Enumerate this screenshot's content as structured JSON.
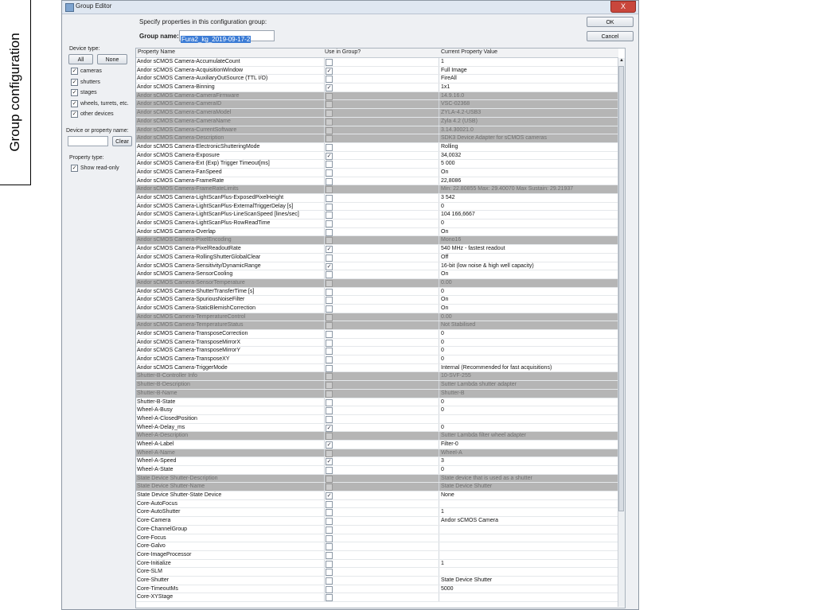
{
  "slide_label": "Group configuration",
  "window": {
    "title": "Group Editor",
    "close_label": "X"
  },
  "header": {
    "specify_text": "Specify properties in this configuration group:",
    "group_name_label": "Group name:",
    "group_name_value": "Fura2_kg_2019-09-17-2"
  },
  "buttons": {
    "ok": "OK",
    "cancel": "Cancel",
    "all": "All",
    "none": "None",
    "clear": "Clear"
  },
  "sidebar": {
    "device_type_label": "Device type:",
    "device_types": [
      {
        "label": "cameras",
        "checked": true
      },
      {
        "label": "shutters",
        "checked": true
      },
      {
        "label": "stages",
        "checked": true
      },
      {
        "label": "wheels, turrets, etc.",
        "checked": true
      },
      {
        "label": "other devices",
        "checked": true
      }
    ],
    "filter_label": "Device or property name:",
    "property_type_label": "Property type:",
    "show_readonly_label": "Show read-only"
  },
  "table": {
    "headers": [
      "Property Name",
      "Use in Group?",
      "Current Property Value"
    ],
    "rows": [
      {
        "name": "Andor sCMOS Camera-AccumulateCount",
        "use": false,
        "value": "1",
        "ro": false
      },
      {
        "name": "Andor sCMOS Camera-AcquisitionWindow",
        "use": true,
        "value": "Full Image",
        "ro": false
      },
      {
        "name": "Andor sCMOS Camera-AuxiliaryOutSource (TTL I/O)",
        "use": false,
        "value": "FireAll",
        "ro": false
      },
      {
        "name": "Andor sCMOS Camera-Binning",
        "use": true,
        "value": "1x1",
        "ro": false
      },
      {
        "name": "Andor sCMOS Camera-CameraFirmware",
        "use": false,
        "value": "14.9.16.0",
        "ro": true
      },
      {
        "name": "Andor sCMOS Camera-CameraID",
        "use": false,
        "value": "VSC-02368",
        "ro": true
      },
      {
        "name": "Andor sCMOS Camera-CameraModel",
        "use": false,
        "value": "ZYLA-4.2-USB3",
        "ro": true
      },
      {
        "name": "Andor sCMOS Camera-CameraName",
        "use": false,
        "value": "Zyla 4.2 (USB)",
        "ro": true
      },
      {
        "name": "Andor sCMOS Camera-CurrentSoftware",
        "use": false,
        "value": "3.14.30021.0",
        "ro": true
      },
      {
        "name": "Andor sCMOS Camera-Description",
        "use": false,
        "value": "SDK3 Device Adapter for sCMOS cameras",
        "ro": true
      },
      {
        "name": "Andor sCMOS Camera-ElectronicShutteringMode",
        "use": false,
        "value": "Rolling",
        "ro": false
      },
      {
        "name": "Andor sCMOS Camera-Exposure",
        "use": true,
        "value": "34,0032",
        "ro": false
      },
      {
        "name": "Andor sCMOS Camera-Ext (Exp) Trigger Timeout[ms]",
        "use": false,
        "value": "5 000",
        "ro": false
      },
      {
        "name": "Andor sCMOS Camera-FanSpeed",
        "use": false,
        "value": "On",
        "ro": false
      },
      {
        "name": "Andor sCMOS Camera-FrameRate",
        "use": false,
        "value": "22,8086",
        "ro": false
      },
      {
        "name": "Andor sCMOS Camera-FrameRateLimits",
        "use": false,
        "value": "Min: 22.80855  Max: 29.40070  Max Sustain: 29.21937",
        "ro": true
      },
      {
        "name": "Andor sCMOS Camera-LightScanPlus-ExposedPixelHeight",
        "use": false,
        "value": "3 542",
        "ro": false
      },
      {
        "name": "Andor sCMOS Camera-LightScanPlus-ExternalTriggerDelay [s]",
        "use": false,
        "value": "0",
        "ro": false
      },
      {
        "name": "Andor sCMOS Camera-LightScanPlus-LineScanSpeed [lines/sec]",
        "use": false,
        "value": "104 166,6667",
        "ro": false
      },
      {
        "name": "Andor sCMOS Camera-LightScanPlus-RowReadTime",
        "use": false,
        "value": "0",
        "ro": false
      },
      {
        "name": "Andor sCMOS Camera-Overlap",
        "use": false,
        "value": "On",
        "ro": false
      },
      {
        "name": "Andor sCMOS Camera-PixelEncoding",
        "use": false,
        "value": "Mono16",
        "ro": true
      },
      {
        "name": "Andor sCMOS Camera-PixelReadoutRate",
        "use": true,
        "value": "540 MHz - fastest readout",
        "ro": false
      },
      {
        "name": "Andor sCMOS Camera-RollingShutterGlobalClear",
        "use": false,
        "value": "Off",
        "ro": false
      },
      {
        "name": "Andor sCMOS Camera-Sensitivity/DynamicRange",
        "use": true,
        "value": "16-bit (low noise & high well capacity)",
        "ro": false
      },
      {
        "name": "Andor sCMOS Camera-SensorCooling",
        "use": false,
        "value": "On",
        "ro": false
      },
      {
        "name": "Andor sCMOS Camera-SensorTemperature",
        "use": false,
        "value": "0.00",
        "ro": true
      },
      {
        "name": "Andor sCMOS Camera-ShutterTransferTime [s]",
        "use": false,
        "value": "0",
        "ro": false
      },
      {
        "name": "Andor sCMOS Camera-SpuriousNoiseFilter",
        "use": false,
        "value": "On",
        "ro": false
      },
      {
        "name": "Andor sCMOS Camera-StaticBlemishCorrection",
        "use": false,
        "value": "On",
        "ro": false
      },
      {
        "name": "Andor sCMOS Camera-TemperatureControl",
        "use": false,
        "value": "0.00",
        "ro": true
      },
      {
        "name": "Andor sCMOS Camera-TemperatureStatus",
        "use": false,
        "value": "Not Stabilised",
        "ro": true
      },
      {
        "name": "Andor sCMOS Camera-TransposeCorrection",
        "use": false,
        "value": "0",
        "ro": false
      },
      {
        "name": "Andor sCMOS Camera-TransposeMirrorX",
        "use": false,
        "value": "0",
        "ro": false
      },
      {
        "name": "Andor sCMOS Camera-TransposeMirrorY",
        "use": false,
        "value": "0",
        "ro": false
      },
      {
        "name": "Andor sCMOS Camera-TransposeXY",
        "use": false,
        "value": "0",
        "ro": false
      },
      {
        "name": "Andor sCMOS Camera-TriggerMode",
        "use": false,
        "value": "Internal (Recommended for fast acquisitions)",
        "ro": false
      },
      {
        "name": "Shutter-B-Controller Info",
        "use": false,
        "value": "10-SVF-255",
        "ro": true
      },
      {
        "name": "Shutter-B-Description",
        "use": false,
        "value": "Sutter Lambda shutter adapter",
        "ro": true
      },
      {
        "name": "Shutter-B-Name",
        "use": false,
        "value": "Shutter-B",
        "ro": true
      },
      {
        "name": "Shutter-B-State",
        "use": false,
        "value": "0",
        "ro": false
      },
      {
        "name": "Wheel-A-Busy",
        "use": false,
        "value": "0",
        "ro": false
      },
      {
        "name": "Wheel-A-ClosedPosition",
        "use": false,
        "value": "",
        "ro": false
      },
      {
        "name": "Wheel-A-Delay_ms",
        "use": true,
        "value": "0",
        "ro": false
      },
      {
        "name": "Wheel-A-Description",
        "use": false,
        "value": "Sutter Lambda filter wheel adapter",
        "ro": true
      },
      {
        "name": "Wheel-A-Label",
        "use": true,
        "value": "Filter-0",
        "ro": false
      },
      {
        "name": "Wheel-A-Name",
        "use": false,
        "value": "Wheel-A",
        "ro": true
      },
      {
        "name": "Wheel-A-Speed",
        "use": true,
        "value": "3",
        "ro": false
      },
      {
        "name": "Wheel-A-State",
        "use": false,
        "value": "0",
        "ro": false
      },
      {
        "name": "State Device Shutter-Description",
        "use": false,
        "value": "State device that is used as a shutter",
        "ro": true
      },
      {
        "name": "State Device Shutter-Name",
        "use": false,
        "value": "State Device Shutter",
        "ro": true
      },
      {
        "name": "State Device Shutter-State Device",
        "use": true,
        "value": "None",
        "ro": false
      },
      {
        "name": "Core-AutoFocus",
        "use": false,
        "value": "",
        "ro": false
      },
      {
        "name": "Core-AutoShutter",
        "use": false,
        "value": "1",
        "ro": false
      },
      {
        "name": "Core-Camera",
        "use": false,
        "value": "Andor sCMOS Camera",
        "ro": false
      },
      {
        "name": "Core-ChannelGroup",
        "use": false,
        "value": "",
        "ro": false
      },
      {
        "name": "Core-Focus",
        "use": false,
        "value": "",
        "ro": false
      },
      {
        "name": "Core-Galvo",
        "use": false,
        "value": "",
        "ro": false
      },
      {
        "name": "Core-ImageProcessor",
        "use": false,
        "value": "",
        "ro": false
      },
      {
        "name": "Core-Initialize",
        "use": false,
        "value": "1",
        "ro": false
      },
      {
        "name": "Core-SLM",
        "use": false,
        "value": "",
        "ro": false
      },
      {
        "name": "Core-Shutter",
        "use": false,
        "value": "State Device Shutter",
        "ro": false
      },
      {
        "name": "Core-TimeoutMs",
        "use": false,
        "value": "5000",
        "ro": false
      },
      {
        "name": "Core-XYStage",
        "use": false,
        "value": "",
        "ro": false
      }
    ]
  }
}
